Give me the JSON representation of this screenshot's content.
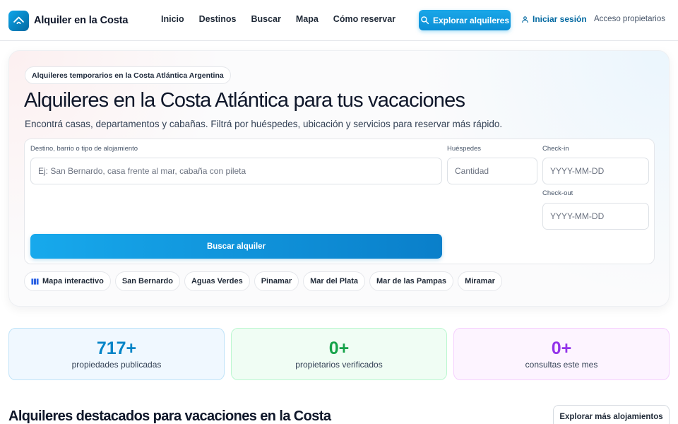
{
  "header": {
    "brand_name": "Alquiler en la Costa",
    "nav": [
      "Inicio",
      "Destinos",
      "Buscar",
      "Mapa",
      "Cómo reservar"
    ],
    "explore_label": "Explorar alquileres",
    "login_label": "Iniciar sesión",
    "owners_label": "Acceso propietarios"
  },
  "hero": {
    "tag": "Alquileres temporarios en la Costa Atlántica Argentina",
    "title": "Alquileres en la Costa Atlántica para tus vacaciones",
    "subtitle": "Encontrá casas, departamentos y cabañas. Filtrá por huéspedes, ubicación y servicios para reservar más rápido."
  },
  "search": {
    "destination_label": "Destino, barrio o tipo de alojamiento",
    "destination_placeholder": "Ej: San Bernardo, casa frente al mar, cabaña con pileta",
    "guests_label": "Huéspedes",
    "guests_placeholder": "Cantidad",
    "checkin_label": "Check-in",
    "checkin_placeholder": "YYYY-MM-DD",
    "checkout_label": "Check-out",
    "checkout_placeholder": "YYYY-MM-DD",
    "submit_label": "Buscar alquiler"
  },
  "chips": [
    "Mapa interactivo",
    "San Bernardo",
    "Aguas Verdes",
    "Pinamar",
    "Mar del Plata",
    "Mar de las Pampas",
    "Miramar"
  ],
  "stats": [
    {
      "value": "717+",
      "label": "propiedades publicadas"
    },
    {
      "value": "0+",
      "label": "propietarios verificados"
    },
    {
      "value": "0+",
      "label": "consultas este mes"
    }
  ],
  "featured": {
    "title": "Alquileres destacados para vacaciones en la Costa",
    "more_label": "Explorar más alojamientos"
  },
  "colors": {
    "accent": "#0ea5e9",
    "accent_dark": "#0369a1",
    "stat_blue": "#0284c7",
    "stat_green": "#16a34a",
    "stat_purple": "#9333ea"
  }
}
